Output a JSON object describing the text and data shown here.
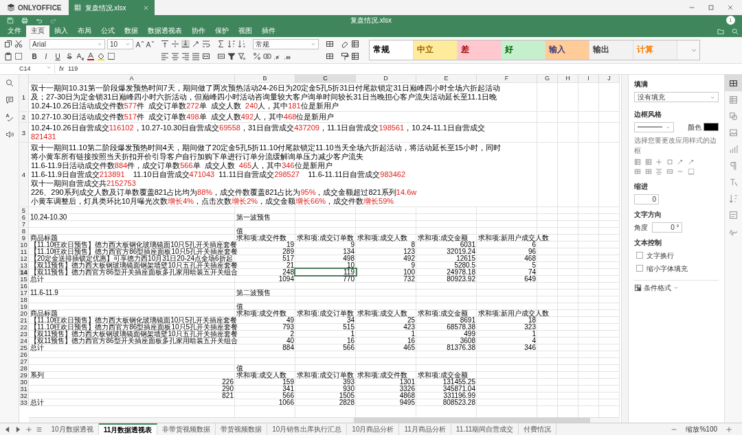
{
  "app": {
    "logo": "ONLYOFFICE",
    "tab": "复盘情况.xlsx",
    "title": "复盘情况.xlsx",
    "user_badge": "1"
  },
  "menu": [
    {
      "label": "文件",
      "selected": false
    },
    {
      "label": "主页",
      "selected": true
    },
    {
      "label": "插入",
      "selected": false
    },
    {
      "label": "布局",
      "selected": false
    },
    {
      "label": "公式",
      "selected": false
    },
    {
      "label": "数据",
      "selected": false
    },
    {
      "label": "数据透视表",
      "selected": false
    },
    {
      "label": "协作",
      "selected": false
    },
    {
      "label": "保护",
      "selected": false
    },
    {
      "label": "视图",
      "selected": false
    },
    {
      "label": "插件",
      "selected": false
    }
  ],
  "toolbar": {
    "font": "Arial",
    "size": "10",
    "format_buttons": [
      "B",
      "I",
      "U",
      "S"
    ],
    "number_format": "常规",
    "styles": [
      {
        "label": "常规",
        "color": "#ffffff",
        "font": {
          "color": "#000000"
        }
      },
      {
        "label": "中立",
        "color": "#ffeb9c",
        "font": {
          "color": "#9c6500"
        }
      },
      {
        "label": "差",
        "color": "#ffc7ce",
        "font": {
          "color": "#9c0006"
        }
      },
      {
        "label": "好",
        "color": "#c6efce",
        "font": {
          "color": "#006100"
        }
      },
      {
        "label": "输入",
        "color": "#ffcc99",
        "font": {
          "color": "#3f3f76"
        }
      },
      {
        "label": "输出",
        "color": "#f2f2f2",
        "font": {
          "color": "#3f3f3f"
        }
      },
      {
        "label": "计算",
        "color": "#f2f2f2",
        "font": {
          "color": "#fa7d00"
        }
      }
    ]
  },
  "formula_bar": {
    "cell": "C14",
    "fx": "fx",
    "value": "119"
  },
  "sheet": {
    "columns": [
      {
        "label": "A",
        "selected": false
      },
      {
        "label": "B",
        "selected": false
      },
      {
        "label": "C",
        "selected": true
      },
      {
        "label": "D",
        "selected": false
      },
      {
        "label": "E",
        "selected": false
      },
      {
        "label": "F",
        "selected": false
      },
      {
        "label": "G",
        "selected": false
      },
      {
        "label": "H",
        "selected": false
      },
      {
        "label": "I",
        "selected": false
      },
      {
        "label": "J",
        "selected": false
      }
    ],
    "rows": [
      {
        "number": "1",
        "selected": false,
        "lines": [
          [
            {
              "text": "双十一期间10.31第一阶段爆发预热时间7天，期间做了两次预热活动24-26日为20定金5孔5折31日付尾款锁定31日巅峰四小时全场六折起活动",
              "highlight": false
            }
          ],
          [
            {
              "text": "及；27-30日为定金锁31日巅峰四小时六折活动，但巅峰四小时活动咨询量较大客户询单时间较长31日当晚担心客户流失活动延长至11.1日晚",
              "highlight": false
            }
          ],
          [
            {
              "text": "10.24-10.26日活动成交件数",
              "highlight": false
            },
            {
              "text": "577",
              "highlight": true
            },
            {
              "text": "件  成交订单数",
              "highlight": false
            },
            {
              "text": "272",
              "highlight": true
            },
            {
              "text": "单  成交人数  ",
              "highlight": false
            },
            {
              "text": "240",
              "highlight": true
            },
            {
              "text": "人，其中",
              "highlight": false
            },
            {
              "text": "181",
              "highlight": true
            },
            {
              "text": "位是新用户",
              "highlight": false
            }
          ]
        ]
      },
      {
        "number": "2",
        "selected": false,
        "lines": [
          [
            {
              "text": "10.27-10.30日活动成交件数",
              "highlight": false
            },
            {
              "text": "517",
              "highlight": true
            },
            {
              "text": "件  成交订单数",
              "highlight": false
            },
            {
              "text": "498",
              "highlight": true
            },
            {
              "text": "单  成交人数",
              "highlight": false
            },
            {
              "text": "492",
              "highlight": true
            },
            {
              "text": "人，其中",
              "highlight": false
            },
            {
              "text": "468",
              "highlight": true
            },
            {
              "text": "位是新用户",
              "highlight": false
            }
          ]
        ]
      },
      {
        "number": "3",
        "selected": false,
        "lines": [
          [
            {
              "text": "10.24-10.26日自营成交",
              "highlight": false
            },
            {
              "text": "116102",
              "highlight": true
            },
            {
              "text": "，10.27-10.30日自营成交",
              "highlight": false
            },
            {
              "text": "69558",
              "highlight": true
            },
            {
              "text": "，31日自营成交",
              "highlight": false
            },
            {
              "text": "437209",
              "highlight": true
            },
            {
              "text": "，11.1日自营成交",
              "highlight": false
            },
            {
              "text": "198561",
              "highlight": true
            },
            {
              "text": "，10.24-11.1日自营成交",
              "highlight": false
            }
          ],
          [
            {
              "text": "821431",
              "highlight": true
            }
          ]
        ]
      },
      {
        "number": "4",
        "selected": false,
        "lines": [
          [
            {
              "text": "双十一期间11.10第二阶段爆发预热时间4天，期间做了20定金5孔5折11.10付尾款锁定11.10当天全场六折起活动，将活动延长至15小时，同时",
              "highlight": false
            }
          ],
          [
            {
              "text": "将小黄车所有链接按照当天折扣开价引导客户自行加购下单进行订单分流缓解询单压力减少客户流失",
              "highlight": false
            }
          ],
          [
            {
              "text": "11.6-11.9日活动成交件数",
              "highlight": false
            },
            {
              "text": "884",
              "highlight": true
            },
            {
              "text": "件，成交订单数",
              "highlight": false
            },
            {
              "text": "566",
              "highlight": true
            },
            {
              "text": "单  成交人数  ",
              "highlight": false
            },
            {
              "text": "465",
              "highlight": true
            },
            {
              "text": "人，其中",
              "highlight": false
            },
            {
              "text": "346",
              "highlight": true
            },
            {
              "text": "位是新用户",
              "highlight": false
            }
          ],
          [
            {
              "text": "11.6-11.9日自营成交",
              "highlight": false
            },
            {
              "text": "213891",
              "highlight": true
            },
            {
              "text": "    11.10日自营成交",
              "highlight": false
            },
            {
              "text": "471043",
              "highlight": true
            },
            {
              "text": "  11.11日自营成交",
              "highlight": false
            },
            {
              "text": "298527",
              "highlight": true
            },
            {
              "text": "    11.6-11.11日自营成交",
              "highlight": false
            },
            {
              "text": "983462",
              "highlight": true
            }
          ],
          [
            {
              "text": "双十一期间自营成交共",
              "highlight": false
            },
            {
              "text": "2152753",
              "highlight": true
            }
          ],
          [
            {
              "text": "226、290系列成交人数及订单数覆盖821占比均为",
              "highlight": false
            },
            {
              "text": "88%",
              "highlight": true
            },
            {
              "text": "，成交件数覆盖821占比为",
              "highlight": false
            },
            {
              "text": "95%",
              "highlight": true
            },
            {
              "text": "，成交金额超过821系列",
              "highlight": false
            },
            {
              "text": "14.6w",
              "highlight": true
            }
          ],
          [
            {
              "text": "小黄车调整后，灯具类环比10月曝光次数",
              "highlight": false
            },
            {
              "text": "增长4%",
              "highlight": true
            },
            {
              "text": "，点击次数",
              "highlight": false
            },
            {
              "text": "增长2%",
              "highlight": true
            },
            {
              "text": "，成交金额",
              "highlight": false
            },
            {
              "text": "增长66%",
              "highlight": true
            },
            {
              "text": "，成交件数",
              "highlight": false
            },
            {
              "text": "增长59%",
              "highlight": true
            }
          ]
        ]
      },
      {
        "number": "5",
        "selected": false
      },
      {
        "number": "6",
        "selected": false,
        "cells": {
          "A": "10.24-10.30",
          "B": "第一波预售"
        }
      },
      {
        "number": "7",
        "selected": false
      },
      {
        "number": "8",
        "selected": false,
        "cells": {
          "B": "值"
        }
      },
      {
        "number": "9",
        "selected": false,
        "cells": {
          "A": "商品标题",
          "B": "求和项:成交件数",
          "C": "求和项:成交订单数",
          "D": "求和项:成交人数",
          "E": "求和项:成交金额",
          "F": "求和项:新用户成交人数"
        }
      },
      {
        "number": "10",
        "selected": false,
        "cells": {
          "A": "【11.10狂欢日预售】德力西大板钢化玻璃镜面10只5孔开关插座套餐",
          "B": "19",
          "C": "9",
          "D": "8",
          "E": "6031",
          "F": "6"
        }
      },
      {
        "number": "11",
        "selected": false,
        "cells": {
          "A": "【11.10狂欢日预售】德力西官方86型插座面板10只5孔开关插座套餐",
          "B": "289",
          "C": "134",
          "D": "123",
          "E": "32019.24",
          "F": "96"
        }
      },
      {
        "number": "12",
        "selected": false,
        "cells": {
          "A": "【20定金送排插锁定优惠】可享德力西10月31日20-24点全场6折起",
          "B": "517",
          "C": "498",
          "D": "492",
          "E": "12615",
          "F": "468"
        }
      },
      {
        "number": "13",
        "selected": false,
        "cells": {
          "A": "【双11预售】德力西大板钢玻璃镜面钢架墙壁10只五孔开关插座套餐",
          "B": "21",
          "C": "10",
          "D": "9",
          "E": "5280.5",
          "F": "5"
        }
      },
      {
        "number": "14",
        "selected": true,
        "cells": {
          "A": "【双11预售】德力西官方86型开关插座面板多孔家用暗装五开关组合",
          "B": "248",
          "C": "119",
          "D": "100",
          "E": "24978.18",
          "F": "74"
        }
      },
      {
        "number": "15",
        "selected": false,
        "cells": {
          "A": "总计",
          "B": "1094",
          "C": "770",
          "D": "732",
          "E": "80923.92",
          "F": "649"
        }
      },
      {
        "number": "16",
        "selected": false
      },
      {
        "number": "17",
        "selected": false,
        "cells": {
          "A": "11.6-11.9",
          "B": "第二波预售"
        }
      },
      {
        "number": "18",
        "selected": false
      },
      {
        "number": "19",
        "selected": false,
        "cells": {
          "B": "值"
        }
      },
      {
        "number": "20",
        "selected": false,
        "cells": {
          "A": "商品标题",
          "B": "求和项:成交件数",
          "C": "求和项:成交订单数",
          "D": "求和项:成交人数",
          "E": "求和项:成交金额",
          "F": "求和项:新用户成交人数"
        }
      },
      {
        "number": "21",
        "selected": false,
        "cells": {
          "A": "【11.10狂欢日预售】德力西大板钢化玻璃镜面10只5孔开关插座套餐",
          "B": "49",
          "C": "34",
          "D": "25",
          "E": "8691",
          "F": "18"
        }
      },
      {
        "number": "22",
        "selected": false,
        "cells": {
          "A": "【11.10狂欢日预售】德力西官方86型插座面板10只5孔开关插座套餐",
          "B": "793",
          "C": "515",
          "D": "423",
          "E": "68578.38",
          "F": "323"
        }
      },
      {
        "number": "23",
        "selected": false,
        "cells": {
          "A": "【双11预售】德力西大板钢玻璃镜面钢架墙壁10只五孔开关插座套餐",
          "B": "2",
          "C": "1",
          "D": "1",
          "E": "499",
          "F": "1"
        }
      },
      {
        "number": "24",
        "selected": false,
        "cells": {
          "A": "【双11预售】德力西官方86型开关插座面板多孔家用暗装五开关组合",
          "B": "40",
          "C": "16",
          "D": "16",
          "E": "3608",
          "F": "4"
        }
      },
      {
        "number": "25",
        "selected": false,
        "cells": {
          "A": "总计",
          "B": "884",
          "C": "566",
          "D": "465",
          "E": "81376.38",
          "F": "346"
        }
      },
      {
        "number": "26",
        "selected": false
      },
      {
        "number": "27",
        "selected": false
      },
      {
        "number": "28",
        "selected": false,
        "cells": {
          "B": "值"
        }
      },
      {
        "number": "29",
        "selected": false,
        "cells": {
          "A": "系列",
          "B": "求和项:成交人数",
          "C": "求和项:成交订单数",
          "D": "求和项:成交件数",
          "E": "求和项:成交金额"
        }
      },
      {
        "number": "30",
        "selected": false,
        "cells": {
          "A": "226",
          "B": "159",
          "C": "393",
          "D": "1301",
          "E": "131455.25"
        }
      },
      {
        "number": "31",
        "selected": false,
        "cells": {
          "A": "290",
          "B": "341",
          "C": "930",
          "D": "3326",
          "E": "345871.04"
        }
      },
      {
        "number": "32",
        "selected": false,
        "cells": {
          "A": "821",
          "B": "566",
          "C": "1505",
          "D": "4868",
          "E": "331196.99"
        }
      },
      {
        "number": "33",
        "selected": false,
        "cells": {
          "A": "总计",
          "B": "1066",
          "C": "2828",
          "D": "9495",
          "E": "808523.28"
        }
      }
    ]
  },
  "panel": {
    "fill_label": "填满",
    "fill_value": "没有填充",
    "border_label": "边框风格",
    "color_label": "颜色",
    "border_swatch": {
      "color": "#000000"
    },
    "border_hint": "选择您要更改应用样式的边框",
    "indent_label": "缩进",
    "indent_value": "0",
    "direction_label": "文字方向",
    "angle_label": "角度",
    "angle_value": "0 °",
    "text_control_label": "文本控制",
    "options": [
      {
        "label": "文字换行",
        "checked": false
      },
      {
        "label": "缩小字体填充",
        "checked": false
      }
    ],
    "conditional": "条件格式"
  },
  "right_sidebar": [
    {
      "kind": "cell",
      "selected": true
    },
    {
      "kind": "table",
      "selected": false
    },
    {
      "kind": "shape",
      "selected": false
    },
    {
      "kind": "image",
      "selected": false
    },
    {
      "kind": "chart",
      "selected": false
    },
    {
      "kind": "paragraph",
      "selected": false
    },
    {
      "kind": "textart",
      "selected": false
    },
    {
      "kind": "pivot",
      "selected": false
    },
    {
      "kind": "slicer",
      "selected": false
    },
    {
      "kind": "signature",
      "selected": false
    }
  ],
  "sheet_tabs": [
    {
      "label": "10月数据透视",
      "selected": false
    },
    {
      "label": "11月数据透视表",
      "selected": true
    },
    {
      "label": "非带货视频数据",
      "selected": false
    },
    {
      "label": "带货视频数据",
      "selected": false
    },
    {
      "label": "10月销售出库执行汇总",
      "selected": false
    },
    {
      "label": "10月商品分析",
      "selected": false
    },
    {
      "label": "11月商品分析",
      "selected": false
    },
    {
      "label": "11.11期间自营成交",
      "selected": false
    },
    {
      "label": "付费情况",
      "selected": false
    }
  ],
  "status_bar": {
    "zoom": "缩放%100"
  }
}
